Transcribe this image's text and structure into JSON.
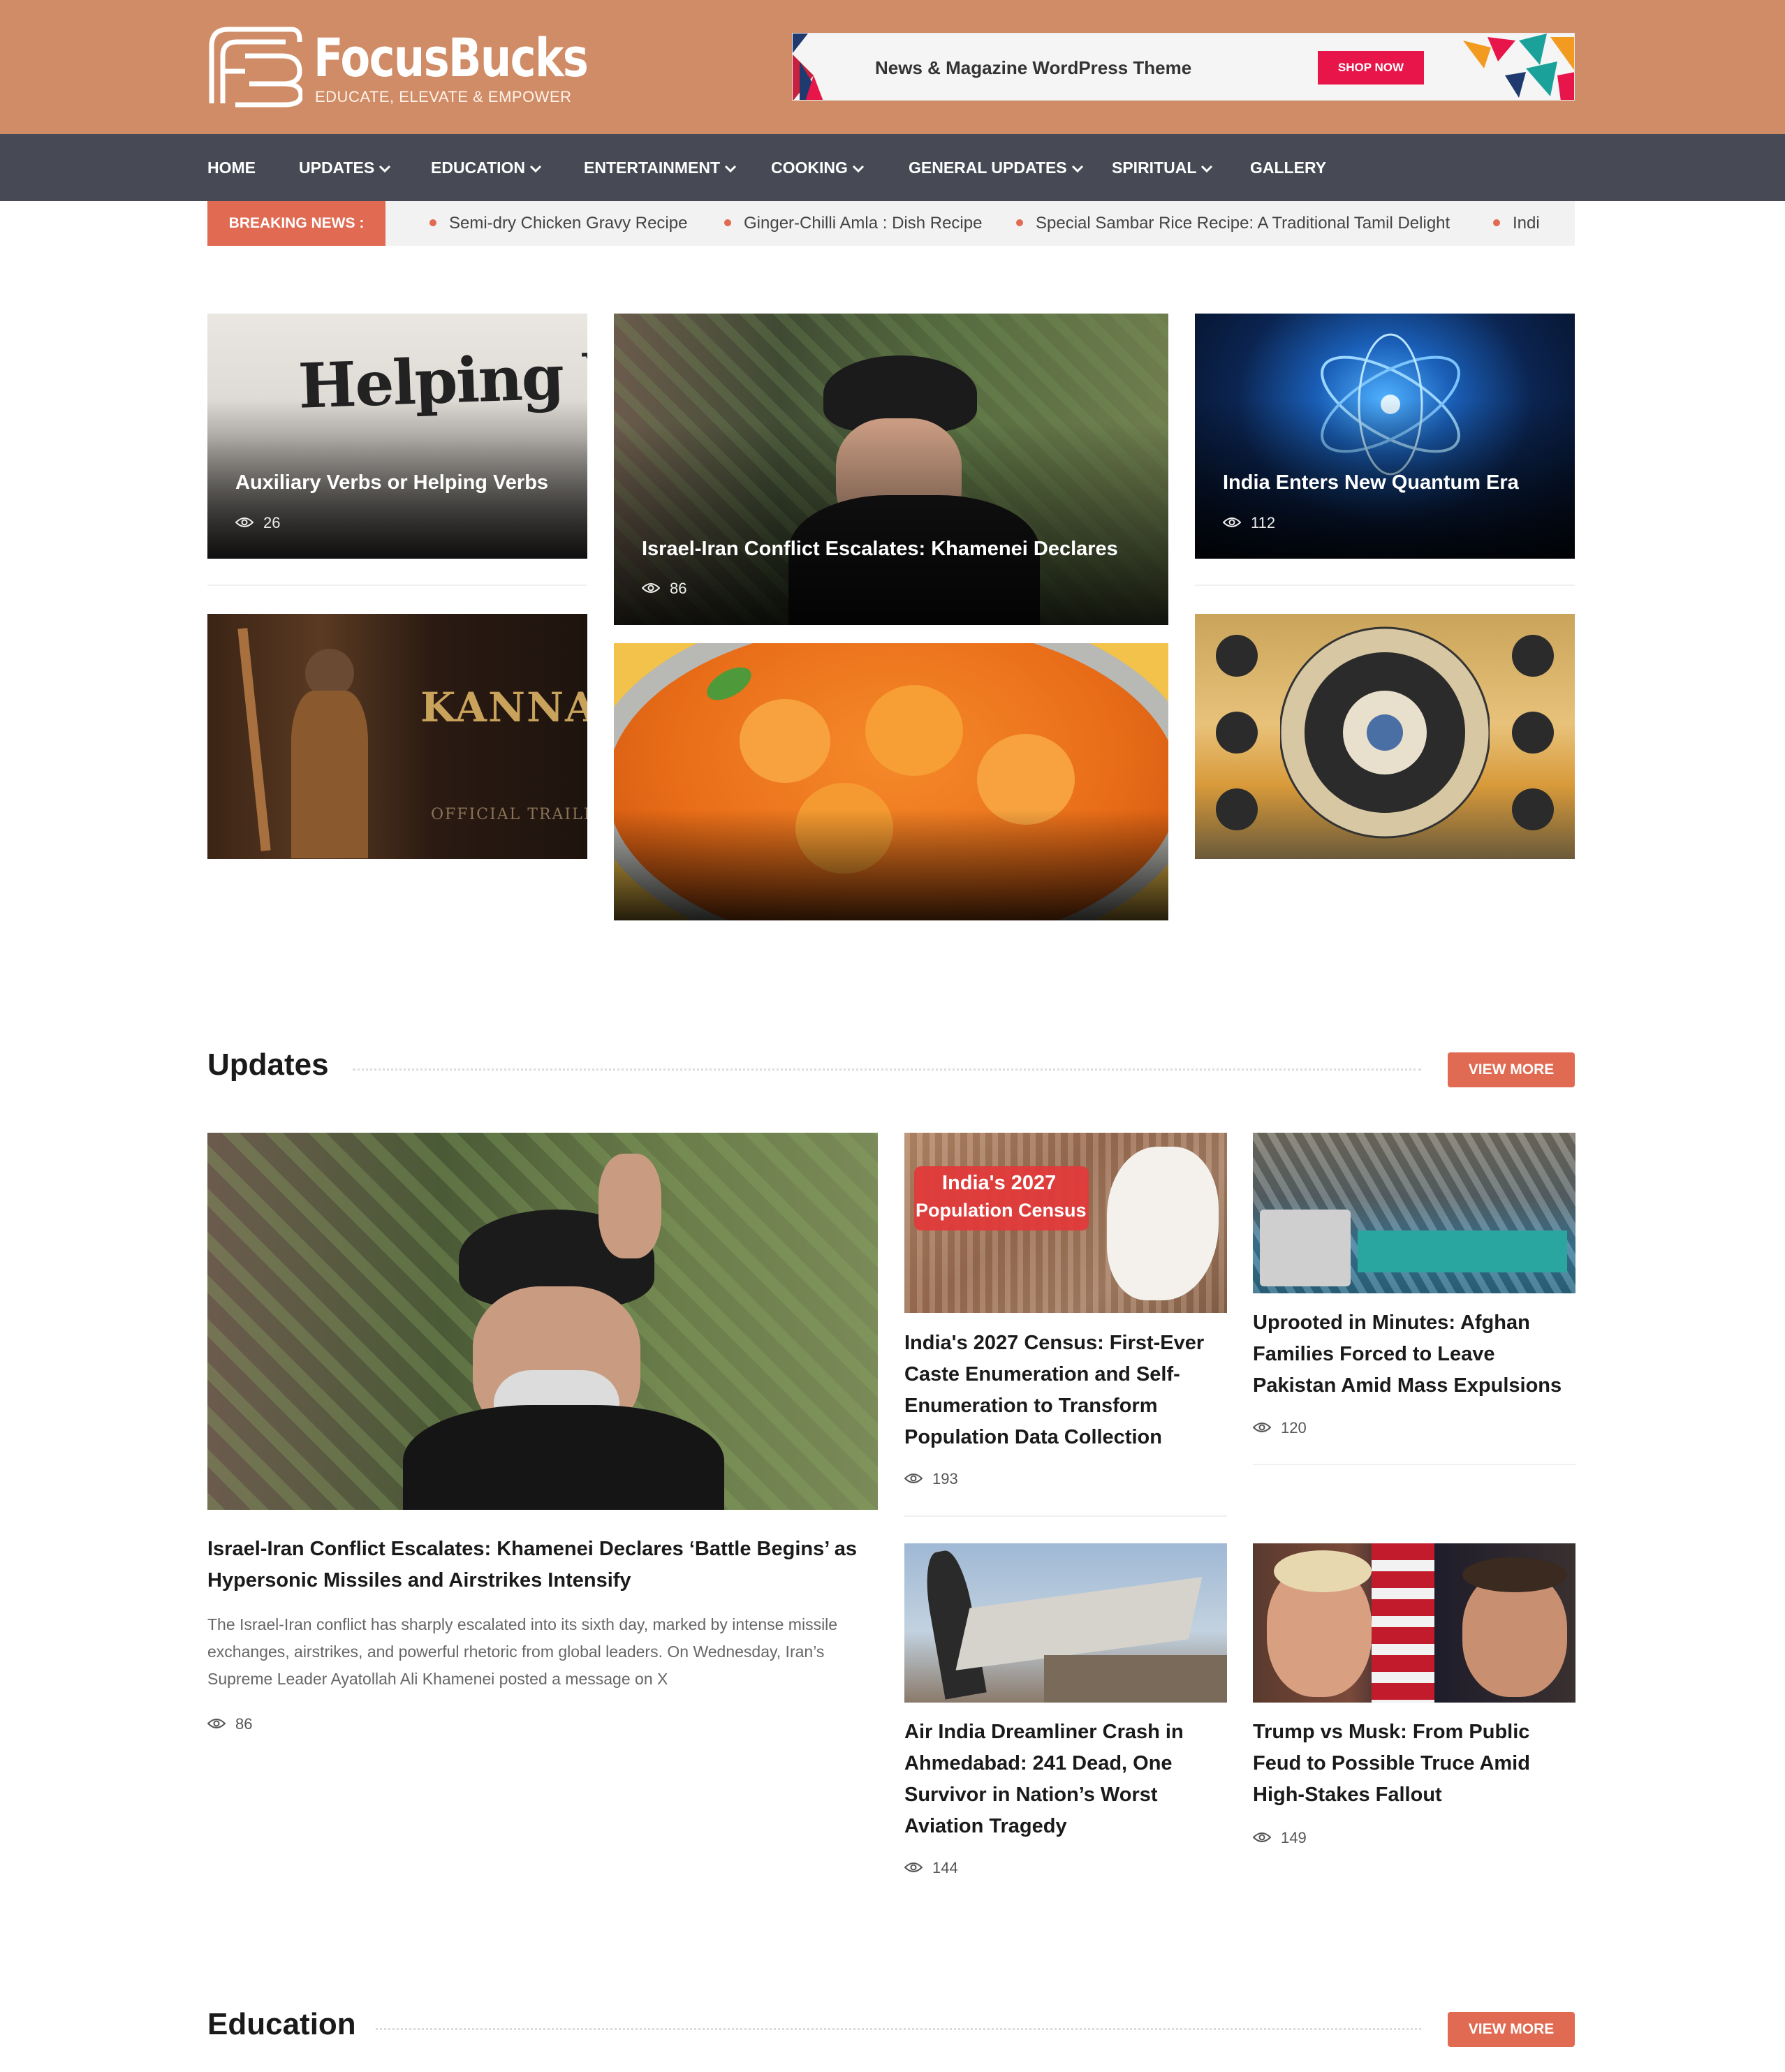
{
  "site": {
    "name": "FocusBucks",
    "tagline": "EDUCATE, ELEVATE & EMPOWER"
  },
  "ad": {
    "text": "News & Magazine WordPress Theme",
    "button": "SHOP NOW"
  },
  "nav": {
    "items": [
      {
        "label": "HOME",
        "dropdown": false
      },
      {
        "label": "UPDATES",
        "dropdown": true
      },
      {
        "label": "EDUCATION",
        "dropdown": true
      },
      {
        "label": "ENTERTAINMENT",
        "dropdown": true
      },
      {
        "label": "COOKING",
        "dropdown": true
      },
      {
        "label": "GENERAL UPDATES",
        "dropdown": true
      },
      {
        "label": "SPIRITUAL",
        "dropdown": true
      },
      {
        "label": "GALLERY",
        "dropdown": false
      }
    ]
  },
  "breaking": {
    "label": "BREAKING NEWS :",
    "items": [
      "Semi-dry Chicken Gravy Recipe",
      "Ginger-Chilli Amla : Dish Recipe",
      "Special Sambar Rice Recipe: A Traditional Tamil Delight",
      "Indi"
    ]
  },
  "featured": {
    "top_left": {
      "title": "Auxiliary Verbs or Helping Verbs",
      "views": "26",
      "image_text": "Helping Verbs"
    },
    "center": {
      "title": "Israel-Iran Conflict Escalates: Khamenei Declares",
      "views": "86"
    },
    "top_right": {
      "title": "India Enters New Quantum Era",
      "views": "112"
    },
    "bottom_left": {
      "image_text": "KANNAPPA",
      "image_sub": "OFFICIAL TRAILER"
    }
  },
  "updates": {
    "title": "Updates",
    "view_more": "VIEW MORE",
    "main": {
      "title": "Israel-Iran Conflict Escalates: Khamenei Declares ‘Battle Begins’ as Hypersonic Missiles and Airstrikes Intensify",
      "excerpt": "The Israel-Iran conflict has sharply escalated into its sixth day, marked by intense missile exchanges, airstrikes, and powerful rhetoric from global leaders. On Wednesday, Iran’s Supreme Leader Ayatollah Ali Khamenei posted a message on X",
      "views": "86"
    },
    "posts": [
      {
        "title": "India's 2027 Census: First-Ever Caste Enumeration and Self-Enumeration to Transform Population Data Collection",
        "views": "193",
        "image_text_1": "India's 2027",
        "image_text_2": "Population Census"
      },
      {
        "title": "Uprooted in Minutes: Afghan Families Forced to Leave Pakistan Amid Mass Expulsions",
        "views": "120"
      },
      {
        "title": "Air India Dreamliner Crash in Ahmedabad: 241 Dead, One Survivor in Nation’s Worst Aviation Tragedy",
        "views": "144"
      },
      {
        "title": "Trump vs Musk: From Public Feud to Possible Truce Amid High-Stakes Fallout",
        "views": "149"
      }
    ]
  },
  "education": {
    "title": "Education",
    "view_more": "VIEW MORE"
  },
  "colors": {
    "header": "#d08c66",
    "nav": "#474a55",
    "accent": "#e06a52"
  },
  "icons": {
    "views": "eye-icon",
    "dropdown": "chevron-down-icon"
  }
}
